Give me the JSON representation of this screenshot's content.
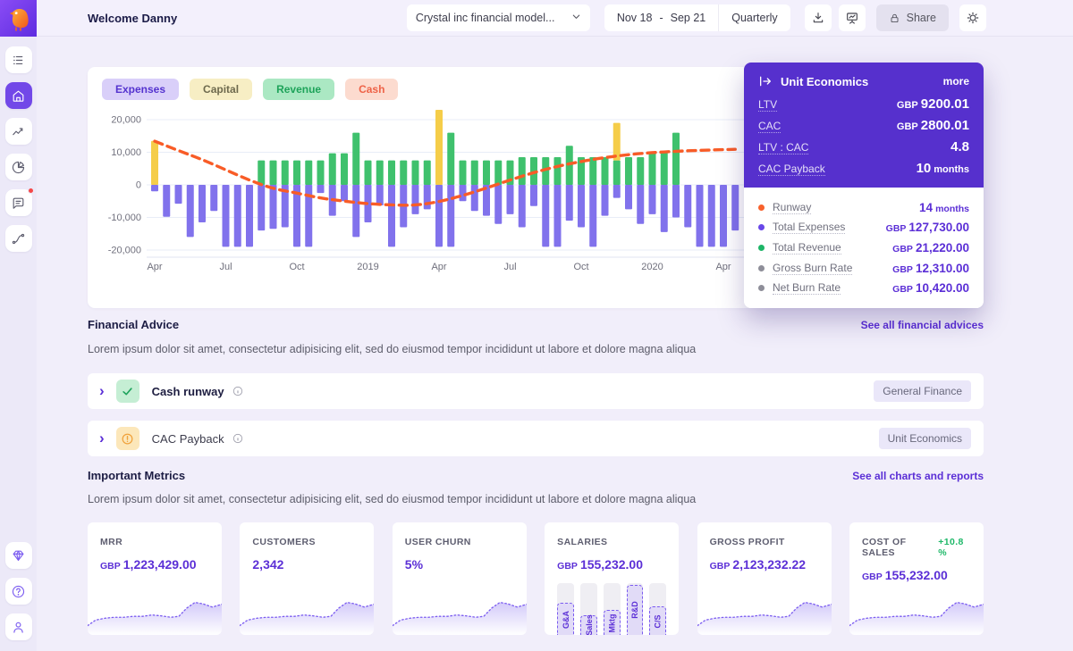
{
  "topbar": {
    "welcome": "Welcome Danny",
    "model": "Crystal inc financial model...",
    "date_from": "Nov 18",
    "date_sep": "-",
    "date_to": "Sep 21",
    "period": "Quarterly",
    "share": "Share"
  },
  "sidebar": {
    "top_icons": [
      "list",
      "home",
      "trends",
      "pie-chart",
      "chat",
      "flows"
    ],
    "active": "home",
    "chat_has_notification": true,
    "bottom_icons": [
      "gem",
      "help",
      "user"
    ]
  },
  "legend_chips": [
    {
      "label": "Expenses",
      "bg": "#d9cff9",
      "color": "#5433cf"
    },
    {
      "label": "Capital",
      "bg": "#f7eec4",
      "color": "#6e6a4e"
    },
    {
      "label": "Revenue",
      "bg": "#abe8c3",
      "color": "#1ea35a"
    },
    {
      "label": "Cash",
      "bg": "#fcdbcf",
      "color": "#ee6247"
    }
  ],
  "chart_data": {
    "type": "bar",
    "note": "monthly stacked bars with dashed cash line, GBP",
    "ylim": [
      -21000,
      24000
    ],
    "y_ticks": [
      [
        20000,
        "20,000"
      ],
      [
        10000,
        "10,000"
      ],
      [
        0,
        "0"
      ],
      [
        -10000,
        "-10,000"
      ],
      [
        -20000,
        "-20,000"
      ]
    ],
    "x_labels": [
      [
        0,
        "Apr"
      ],
      [
        6,
        "Jul"
      ],
      [
        12,
        "Oct"
      ],
      [
        18,
        "2019"
      ],
      [
        24,
        "Apr"
      ],
      [
        30,
        "Jul"
      ],
      [
        36,
        "Oct"
      ],
      [
        42,
        "2020"
      ],
      [
        48,
        "Apr"
      ]
    ],
    "series": [
      {
        "name": "Expenses",
        "color": "#8172ec",
        "values": [
          -2000,
          -9800,
          -5800,
          -16000,
          -11500,
          -8000,
          -19000,
          -19000,
          -19000,
          -14000,
          -13500,
          -13000,
          -19000,
          -19000,
          -2500,
          -9500,
          -5000,
          -16000,
          -11500,
          -6300,
          -19000,
          -13000,
          -9000,
          -7500,
          -19000,
          -19000,
          -5000,
          -8000,
          -9500,
          -12000,
          -9000,
          -13000,
          -6500,
          -19000,
          -19000,
          -11000,
          -13000,
          -19000,
          -9500,
          -4000,
          -7500,
          -12000,
          -9000,
          -14500,
          -10000,
          -13000,
          -19000,
          -19000,
          -19000,
          -14000
        ]
      },
      {
        "name": "Revenue",
        "color": "#3fc16d",
        "values": [
          0,
          0,
          0,
          0,
          0,
          0,
          0,
          0,
          0,
          7500,
          7500,
          7500,
          7500,
          7500,
          7500,
          9700,
          9700,
          16000,
          7500,
          7500,
          7500,
          7500,
          7500,
          7500,
          0,
          16000,
          7500,
          7500,
          7500,
          7500,
          7500,
          8500,
          8500,
          8500,
          8500,
          12000,
          8500,
          8500,
          8500,
          7500,
          8500,
          8500,
          10000,
          10000,
          16000,
          0,
          0,
          0,
          0,
          0
        ]
      },
      {
        "name": "Capital",
        "color": "#f5cd49",
        "values": [
          13500,
          0,
          0,
          0,
          0,
          0,
          0,
          0,
          0,
          0,
          0,
          0,
          0,
          0,
          0,
          0,
          0,
          0,
          0,
          0,
          0,
          0,
          0,
          0,
          23000,
          0,
          0,
          0,
          0,
          0,
          0,
          0,
          0,
          0,
          0,
          0,
          0,
          0,
          0,
          11500,
          0,
          0,
          0,
          0,
          0,
          0,
          0,
          0,
          0,
          0
        ]
      },
      {
        "name": "Cash",
        "color": "#f85c27",
        "style": "dashed-line",
        "points": [
          [
            0,
            13400
          ],
          [
            2,
            10500
          ],
          [
            4,
            7800
          ],
          [
            6,
            4600
          ],
          [
            8,
            1400
          ],
          [
            10,
            -1200
          ],
          [
            12,
            -2500
          ],
          [
            14,
            -4100
          ],
          [
            16,
            -5000
          ],
          [
            18,
            -5800
          ],
          [
            20,
            -6200
          ],
          [
            22,
            -6300
          ],
          [
            24,
            -5200
          ],
          [
            26,
            -3300
          ],
          [
            28,
            -1000
          ],
          [
            30,
            1500
          ],
          [
            32,
            3800
          ],
          [
            34,
            5700
          ],
          [
            36,
            7200
          ],
          [
            38,
            8400
          ],
          [
            40,
            9300
          ],
          [
            42,
            9900
          ],
          [
            44,
            10300
          ],
          [
            46,
            10600
          ],
          [
            48,
            10800
          ],
          [
            49,
            10900
          ]
        ]
      }
    ]
  },
  "unit_economics": {
    "title": "Unit Economics",
    "more": "more",
    "rows": [
      {
        "label": "LTV",
        "prefix": "GBP",
        "value": "9200.01"
      },
      {
        "label": "CAC",
        "prefix": "GBP",
        "value": "2800.01"
      },
      {
        "label": "LTV : CAC",
        "value": "4.8"
      },
      {
        "label": "CAC Payback",
        "value": "10",
        "suffix": "months"
      }
    ],
    "stats": [
      {
        "label": "Runway",
        "value": "14",
        "suffix": "months",
        "dot": "#f8612c"
      },
      {
        "label": "Total Expenses",
        "prefix": "GBP",
        "value": "127,730.00",
        "dot": "#6847e8"
      },
      {
        "label": "Total Revenue",
        "prefix": "GBP",
        "value": "21,220.00",
        "dot": "#1db567"
      },
      {
        "label": "Gross Burn Rate",
        "prefix": "GBP",
        "value": "12,310.00",
        "dot": "#8e8e99"
      },
      {
        "label": "Net Burn Rate",
        "prefix": "GBP",
        "value": "10,420.00",
        "dot": "#8e8e99"
      }
    ]
  },
  "financial_advice": {
    "title": "Financial Advice",
    "link": "See all financial advices",
    "subtitle": "Lorem ipsum dolor sit amet, consectetur adipisicing elit, sed do eiusmod tempor incididunt ut labore et dolore magna aliqua",
    "items": [
      {
        "title": "Cash runway",
        "badge": "General Finance",
        "status": "ok",
        "bold": true
      },
      {
        "title": "CAC Payback",
        "badge": "Unit Economics",
        "status": "warn",
        "bold": false
      }
    ]
  },
  "important_metrics": {
    "title": "Important Metrics",
    "link": "See all charts and reports",
    "subtitle": "Lorem ipsum dolor sit amet, consectetur adipisicing elit, sed do eiusmod tempor incididunt ut labore et dolore magna aliqua",
    "cards": [
      {
        "title": "MRR",
        "prefix": "GBP",
        "value": "1,223,429.00",
        "viz": "spark"
      },
      {
        "title": "CUSTOMERS",
        "value": "2,342",
        "viz": "spark"
      },
      {
        "title": "USER CHURN",
        "value": "5%",
        "viz": "spark"
      },
      {
        "title": "SALARIES",
        "prefix": "GBP",
        "value": "155,232.00",
        "viz": "bars",
        "bar_labels": [
          "G&A",
          "Sales",
          "Mktg",
          "R&D",
          "C/S"
        ],
        "bar_percents": [
          62,
          38,
          48,
          97,
          55
        ]
      },
      {
        "title": "GROSS PROFIT",
        "prefix": "GBP",
        "value": "2,123,232.22",
        "viz": "spark"
      },
      {
        "title": "COST OF SALES",
        "delta": "+10.8 %",
        "prefix": "GBP",
        "value": "155,232.00",
        "viz": "spark"
      }
    ],
    "sparkline": [
      [
        0,
        80
      ],
      [
        6,
        68
      ],
      [
        13,
        64
      ],
      [
        20,
        62
      ],
      [
        27,
        62
      ],
      [
        34,
        60
      ],
      [
        41,
        60
      ],
      [
        48,
        57
      ],
      [
        55,
        59
      ],
      [
        62,
        62
      ],
      [
        68,
        60
      ],
      [
        74,
        42
      ],
      [
        80,
        30
      ],
      [
        86,
        33
      ],
      [
        93,
        40
      ],
      [
        100,
        34
      ]
    ]
  }
}
